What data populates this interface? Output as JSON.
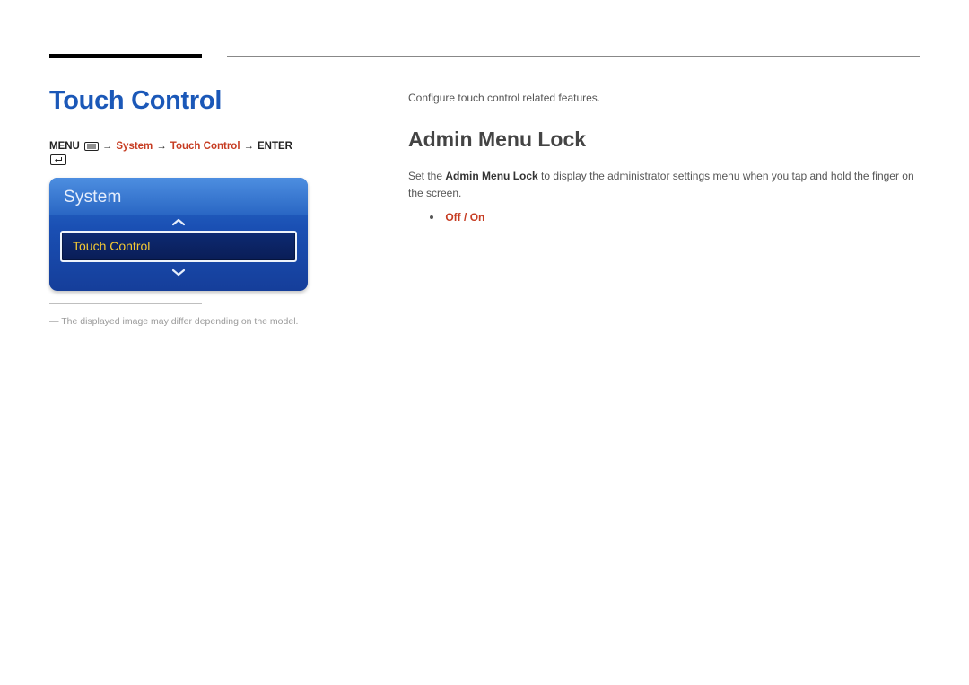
{
  "page": {
    "title": "Touch Control"
  },
  "breadcrumb": {
    "menu_label": "MENU",
    "arrow": "→",
    "system": "System",
    "touch_control": "Touch Control",
    "enter_label": "ENTER"
  },
  "osd": {
    "header": "System",
    "selected_item": "Touch Control"
  },
  "footnote": {
    "text": "― The displayed image may differ depending on the model."
  },
  "right": {
    "intro": "Configure touch control related features.",
    "section_heading": "Admin Menu Lock",
    "body_prefix": "Set the ",
    "body_bold": "Admin Menu Lock",
    "body_suffix": " to display the administrator settings menu when you tap and hold the finger on the screen.",
    "options": {
      "off": "Off",
      "slash": " / ",
      "on": "On"
    }
  }
}
